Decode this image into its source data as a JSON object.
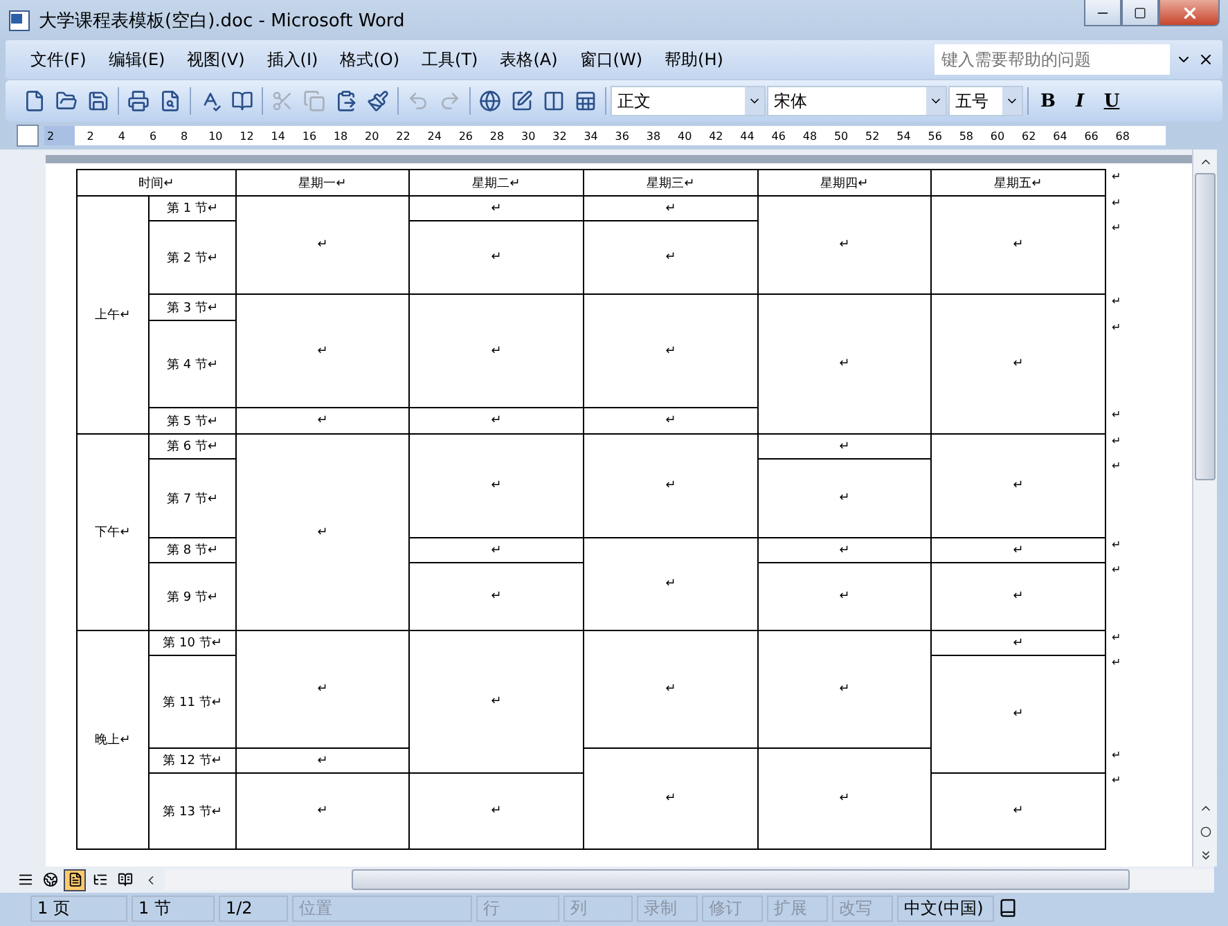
{
  "window": {
    "title": "大学课程表模板(空白).doc - Microsoft Word"
  },
  "menu": [
    "文件(F)",
    "编辑(E)",
    "视图(V)",
    "插入(I)",
    "格式(O)",
    "工具(T)",
    "表格(A)",
    "窗口(W)",
    "帮助(H)"
  ],
  "help_box": {
    "placeholder": "键入需要帮助的问题"
  },
  "toolbar": {
    "buttons": [
      {
        "kind": "new",
        "disabled": false
      },
      {
        "kind": "open",
        "disabled": false
      },
      {
        "kind": "save",
        "disabled": false
      },
      {
        "kind": "separator"
      },
      {
        "kind": "print",
        "disabled": false
      },
      {
        "kind": "preview",
        "disabled": false
      },
      {
        "kind": "separator"
      },
      {
        "kind": "spelling",
        "disabled": false
      },
      {
        "kind": "research",
        "disabled": false
      },
      {
        "kind": "separator"
      },
      {
        "kind": "cut",
        "disabled": true
      },
      {
        "kind": "copy",
        "disabled": true
      },
      {
        "kind": "paste",
        "disabled": false
      },
      {
        "kind": "painter",
        "disabled": false
      },
      {
        "kind": "separator"
      },
      {
        "kind": "undo",
        "disabled": true
      },
      {
        "kind": "redo",
        "disabled": true
      },
      {
        "kind": "separator"
      },
      {
        "kind": "link",
        "disabled": false
      },
      {
        "kind": "table",
        "disabled": false
      },
      {
        "kind": "columns",
        "disabled": false
      },
      {
        "kind": "sheet",
        "disabled": false
      }
    ],
    "style": "正文",
    "font": "宋体",
    "size": "五号",
    "format": [
      {
        "kind": "bold",
        "label": "B"
      },
      {
        "kind": "italic",
        "label": "I"
      },
      {
        "kind": "underline",
        "label": "U"
      }
    ]
  },
  "ruler": {
    "start": "2",
    "ticks": [
      "2",
      "4",
      "6",
      "8",
      "10",
      "12",
      "14",
      "16",
      "18",
      "20",
      "22",
      "24",
      "26",
      "28",
      "30",
      "32",
      "34",
      "36",
      "38",
      "40",
      "42",
      "44",
      "46",
      "48",
      "50",
      "52",
      "54",
      "56",
      "58",
      "60",
      "62",
      "64",
      "66",
      "68"
    ]
  },
  "table": {
    "time_header": "时间↵",
    "header_end": "↵",
    "days": [
      {
        "label": "星期一↵",
        "cells": [
          {
            "kind": "cell",
            "text": "↵"
          },
          {
            "kind": "continued"
          },
          {
            "kind": "cell",
            "text": "↵"
          },
          {
            "kind": "continued"
          },
          {
            "kind": "cell",
            "text": "↵"
          },
          {
            "kind": "cell",
            "text": "↵"
          },
          {
            "kind": "continued"
          },
          {
            "kind": "continued"
          },
          {
            "kind": "continued"
          },
          {
            "kind": "cell",
            "text": "↵"
          },
          {
            "kind": "continued"
          },
          {
            "kind": "cell",
            "text": "↵"
          },
          {
            "kind": "cell",
            "text": "↵"
          }
        ]
      },
      {
        "label": "星期二↵",
        "cells": [
          {
            "kind": "cell",
            "text": "↵"
          },
          {
            "kind": "cell",
            "text": "↵"
          },
          {
            "kind": "cell",
            "text": "↵"
          },
          {
            "kind": "continued"
          },
          {
            "kind": "cell",
            "text": "↵"
          },
          {
            "kind": "cell",
            "text": "↵"
          },
          {
            "kind": "continued"
          },
          {
            "kind": "cell",
            "text": "↵"
          },
          {
            "kind": "cell",
            "text": "↵"
          },
          {
            "kind": "cell",
            "text": "↵"
          },
          {
            "kind": "continued"
          },
          {
            "kind": "continued"
          },
          {
            "kind": "cell",
            "text": "↵"
          }
        ]
      },
      {
        "label": "星期三↵",
        "cells": [
          {
            "kind": "cell",
            "text": "↵"
          },
          {
            "kind": "cell",
            "text": "↵"
          },
          {
            "kind": "cell",
            "text": "↵"
          },
          {
            "kind": "continued"
          },
          {
            "kind": "cell",
            "text": "↵"
          },
          {
            "kind": "cell",
            "text": "↵"
          },
          {
            "kind": "continued"
          },
          {
            "kind": "cell",
            "text": "↵"
          },
          {
            "kind": "continued"
          },
          {
            "kind": "cell",
            "text": "↵"
          },
          {
            "kind": "continued"
          },
          {
            "kind": "cell",
            "text": "↵"
          },
          {
            "kind": "continued"
          }
        ]
      },
      {
        "label": "星期四↵",
        "cells": [
          {
            "kind": "cell",
            "text": "↵"
          },
          {
            "kind": "continued"
          },
          {
            "kind": "cell",
            "text": "↵"
          },
          {
            "kind": "continued"
          },
          {
            "kind": "continued"
          },
          {
            "kind": "cell",
            "text": "↵"
          },
          {
            "kind": "cell",
            "text": "↵"
          },
          {
            "kind": "cell",
            "text": "↵"
          },
          {
            "kind": "cell",
            "text": "↵"
          },
          {
            "kind": "cell",
            "text": "↵"
          },
          {
            "kind": "continued"
          },
          {
            "kind": "cell",
            "text": "↵"
          },
          {
            "kind": "continued"
          }
        ]
      },
      {
        "label": "星期五↵",
        "cells": [
          {
            "kind": "cell",
            "text": "↵"
          },
          {
            "kind": "continued"
          },
          {
            "kind": "cell",
            "text": "↵"
          },
          {
            "kind": "continued"
          },
          {
            "kind": "continued"
          },
          {
            "kind": "cell",
            "text": "↵"
          },
          {
            "kind": "continued"
          },
          {
            "kind": "cell",
            "text": "↵"
          },
          {
            "kind": "cell",
            "text": "↵"
          },
          {
            "kind": "cell",
            "text": "↵"
          },
          {
            "kind": "cell",
            "text": "↵"
          },
          {
            "kind": "continued"
          },
          {
            "kind": "cell",
            "text": "↵"
          }
        ]
      }
    ],
    "sessions": [
      {
        "label": "上午↵",
        "periods": [
          {
            "label": "第 1 节↵",
            "end": "↵"
          },
          {
            "label": "第 2 节↵",
            "end": "↵"
          },
          {
            "label": "第 3 节↵",
            "end": "↵"
          },
          {
            "label": "第 4 节↵",
            "end": "↵"
          },
          {
            "label": "第 5 节↵",
            "end": "↵"
          }
        ]
      },
      {
        "label": "下午↵",
        "periods": [
          {
            "label": "第 6 节↵",
            "end": "↵"
          },
          {
            "label": "第 7 节↵",
            "end": "↵"
          },
          {
            "label": "第 8 节↵",
            "end": "↵"
          },
          {
            "label": "第 9 节↵",
            "end": "↵"
          }
        ]
      },
      {
        "label": "晚上↵",
        "periods": [
          {
            "label": "第 10 节↵",
            "end": "↵"
          },
          {
            "label": "第 11 节↵",
            "end": "↵"
          },
          {
            "label": "第 12 节↵",
            "end": "↵"
          },
          {
            "label": "第 13 节↵",
            "end": "↵"
          }
        ]
      }
    ]
  },
  "views": [
    {
      "kind": "normal",
      "selected": false
    },
    {
      "kind": "web",
      "selected": false
    },
    {
      "kind": "print",
      "selected": true
    },
    {
      "kind": "outline",
      "selected": false
    },
    {
      "kind": "reading",
      "selected": false
    }
  ],
  "status_bar": {
    "fields": [
      {
        "text": "1 页",
        "disabled": false
      },
      {
        "text": "1 节",
        "disabled": false
      },
      {
        "text": "1/2",
        "disabled": false
      },
      {
        "text": "位置",
        "disabled": true
      },
      {
        "text": "行",
        "disabled": true
      },
      {
        "text": "列",
        "disabled": true
      },
      {
        "text": "录制",
        "disabled": true
      },
      {
        "text": "修订",
        "disabled": true
      },
      {
        "text": "扩展",
        "disabled": true
      },
      {
        "text": "改写",
        "disabled": true
      },
      {
        "text": "中文(中国)",
        "disabled": false
      }
    ]
  }
}
